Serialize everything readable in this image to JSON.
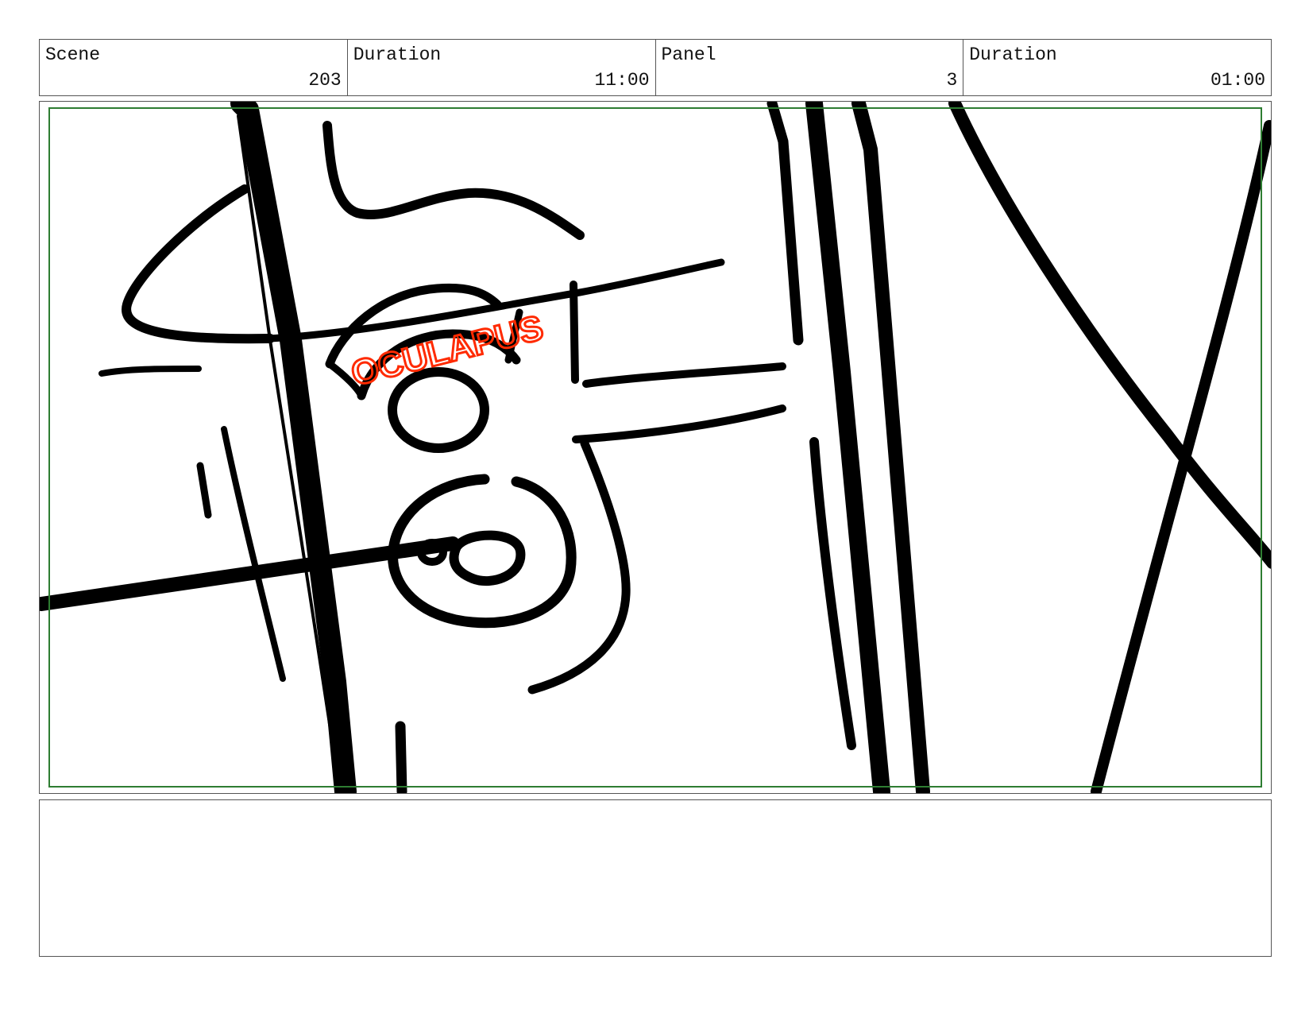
{
  "header": {
    "scene_label": "Scene",
    "scene_value": "203",
    "duration_label": "Duration",
    "duration_value": "11:00",
    "panel_label": "Panel",
    "panel_value": "3",
    "panel_duration_label": "Duration",
    "panel_duration_value": "01:00"
  },
  "sketch": {
    "annotation_text": "OCULAPUS",
    "ink_color": "#000000",
    "annotation_color": "#ff2a00",
    "safe_area_color": "#2e7d32"
  },
  "notes": {
    "text": ""
  }
}
